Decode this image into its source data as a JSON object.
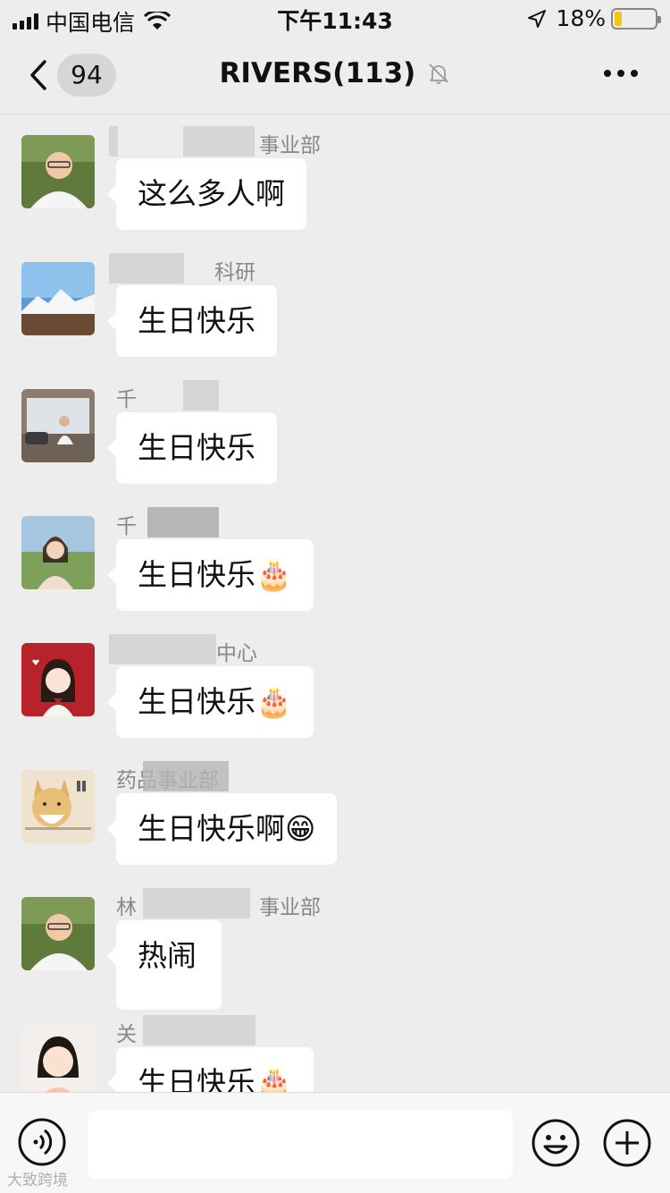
{
  "status_bar": {
    "carrier": "中国电信",
    "time": "下午11:43",
    "battery": "18%",
    "battery_level": 0.18
  },
  "header": {
    "back_badge": "94",
    "title": "RIVERS(113)",
    "icons": [
      "chevron-left-icon",
      "bell-muted-icon",
      "more-icon"
    ]
  },
  "messages": [
    {
      "sender": "事业部",
      "text": "这么多人啊",
      "emoji": ""
    },
    {
      "sender": "科研",
      "text": "生日快乐",
      "emoji": ""
    },
    {
      "sender": "千",
      "text": "生日快乐",
      "emoji": ""
    },
    {
      "sender": "千",
      "text": "生日快乐",
      "emoji": "🎂"
    },
    {
      "sender": "中心",
      "text": "生日快乐",
      "emoji": "🎂"
    },
    {
      "sender": "药品事业部",
      "text": "生日快乐啊",
      "emoji": "😁"
    },
    {
      "sender": "林",
      "text": "热闹",
      "emoji": ""
    },
    {
      "sender": "关",
      "text": "生日快乐",
      "emoji": "🎂"
    }
  ],
  "input_bar": {
    "placeholder": "",
    "icons": [
      "voice-icon",
      "emoji-icon",
      "plus-icon"
    ]
  },
  "watermark": "大致跨境"
}
